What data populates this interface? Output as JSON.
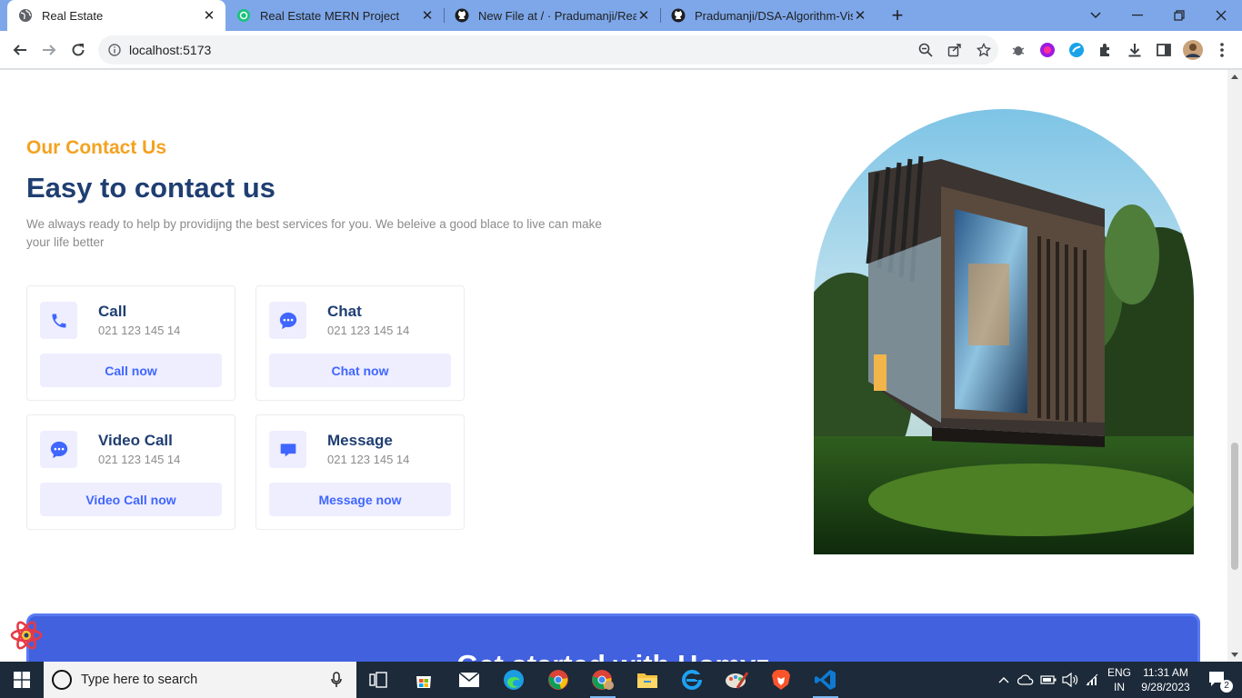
{
  "browser": {
    "tabs": [
      {
        "title": "Real Estate",
        "active": true,
        "icon": "globe-icon"
      },
      {
        "title": "Real Estate MERN Project",
        "active": false,
        "icon": "openai-icon"
      },
      {
        "title": "New File at / · Pradumanji/Real-Es",
        "active": false,
        "icon": "github-icon"
      },
      {
        "title": "Pradumanji/DSA-Algorithm-Visua",
        "active": false,
        "icon": "github-icon"
      }
    ],
    "url": "localhost:5173"
  },
  "page": {
    "subtitle": "Our Contact Us",
    "title": "Easy to contact us",
    "description": "We always ready to help by providijng the best services for you. We beleive a good blace to live can make your life better",
    "cards": [
      {
        "title": "Call",
        "number": "021 123 145 14",
        "button": "Call now",
        "icon": "phone-icon"
      },
      {
        "title": "Chat",
        "number": "021 123 145 14",
        "button": "Chat now",
        "icon": "chat-icon"
      },
      {
        "title": "Video Call",
        "number": "021 123 145 14",
        "button": "Video Call now",
        "icon": "chat-icon"
      },
      {
        "title": "Message",
        "number": "021 123 145 14",
        "button": "Message now",
        "icon": "message-icon"
      }
    ],
    "banner_title": "Get started with Homyz",
    "colors": {
      "accent_orange": "#f3a221",
      "heading_blue": "#1f3e72",
      "button_blue": "#4066ff",
      "banner": "#4161df"
    }
  },
  "taskbar": {
    "search_placeholder": "Type here to search",
    "language": "ENG",
    "region": "IN",
    "time": "11:31 AM",
    "date": "9/28/2023",
    "notifications": "2"
  }
}
